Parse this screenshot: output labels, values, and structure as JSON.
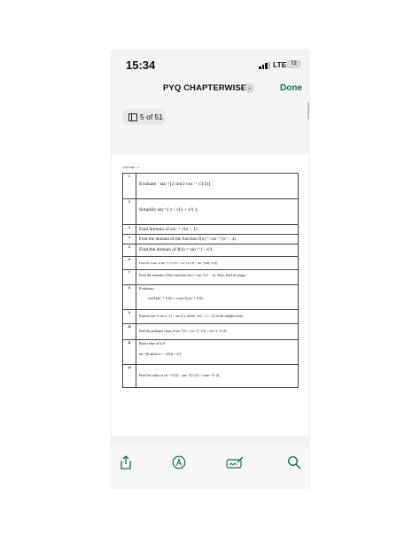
{
  "status": {
    "time": "15:34",
    "network": "LTE",
    "battery": "72"
  },
  "nav": {
    "title": "PYQ CHAPTERWISE",
    "done": "Done"
  },
  "page_counter": "5 of 51",
  "document": {
    "chapter": "CHAPTER - 2",
    "rows": [
      {
        "n": "1",
        "text": "Evaluate : tan⁻¹[2 sin(2 cos⁻¹ √3/2)]"
      },
      {
        "n": "2",
        "text": "Simplify  sin⁻¹( x / √(1 + x²) )."
      },
      {
        "n": "3",
        "text": "Find domain of  sin⁻¹ √(x − 1) ."
      },
      {
        "n": "4",
        "text": "Find the domain of the function f(x) = cos⁻¹ (x² − 4)."
      },
      {
        "n": "5",
        "text": "Find the domain of  f(x) = sin⁻¹ (− x²)."
      },
      {
        "n": "6",
        "text": "Find the value of tan⁻¹(−1/√3) + cot⁻¹(1/√3) + tan⁻¹[sin(−π/2)]"
      },
      {
        "n": "7",
        "text": "Find the domain of the function f(x) = sin⁻¹(x² − 4). Also, find its range."
      },
      {
        "n": "8",
        "text": "Evaluate :",
        "sub": "cos²(tan⁻¹ 1/2) + cosec²(cot⁻¹ 1/3)"
      },
      {
        "n": "9",
        "text": "Express tan⁻¹( cos x / (1 − sin x) ), where −π/2 < x < π/2 in the simplest form."
      },
      {
        "n": "10",
        "text": "Find the principal value of tan⁻¹(1) + cos⁻¹(−1/2) + sin⁻¹(−1/√2)"
      },
      {
        "n": "11",
        "text": "Find value of k if",
        "sub": "sin⁻¹[k tan(2cos⁻¹ √3/2)] = π/3"
      },
      {
        "n": "12",
        "text": "Find the value of  sec⁻¹(1/2) − tan⁻¹(1/√3) + cosec⁻¹(−2)."
      }
    ]
  },
  "toolbar": {
    "icons": [
      "share-icon",
      "markup-icon",
      "signature-icon",
      "search-icon"
    ]
  },
  "colors": {
    "accent": "#1e6e4c"
  }
}
